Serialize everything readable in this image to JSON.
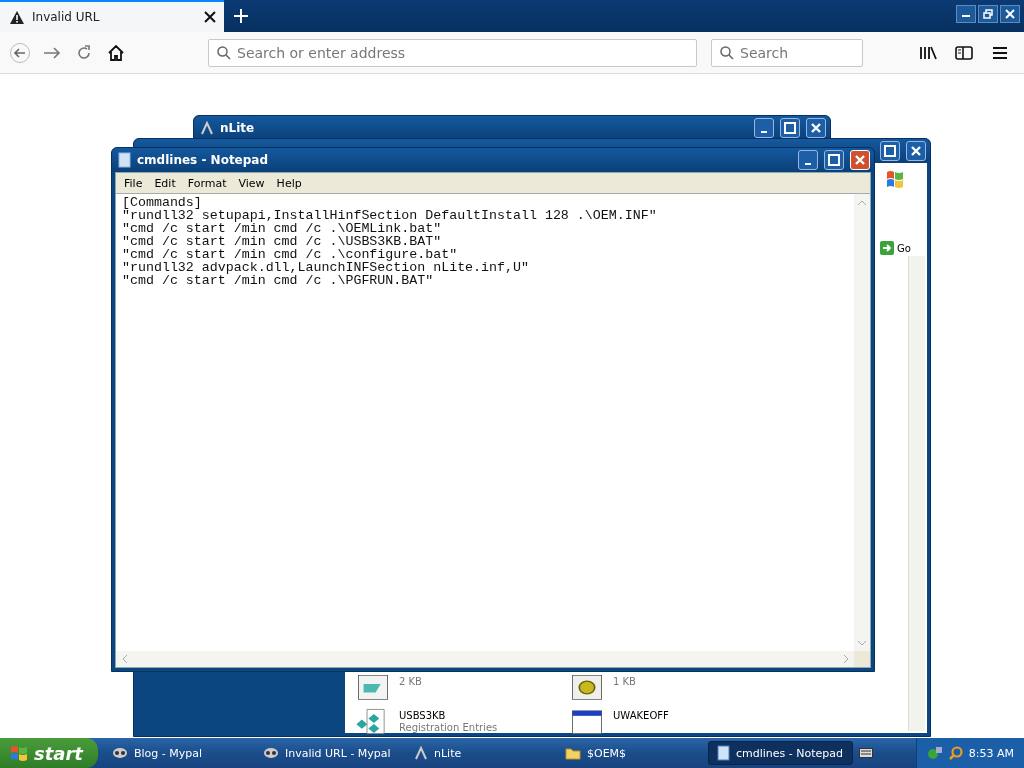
{
  "browser": {
    "tab": {
      "title": "Invalid URL"
    },
    "address_bar": {
      "placeholder": "Search or enter address"
    },
    "search_bar": {
      "placeholder": "Search"
    }
  },
  "nlite_window": {
    "title": "nLite"
  },
  "explorer_window": {
    "go_button": "Go",
    "files": [
      {
        "details": [
          "2 KB"
        ],
        "kind": "script"
      },
      {
        "details": [
          "1 KB"
        ],
        "kind": "batch"
      },
      {
        "name": "USBS3KB",
        "details": [
          "Registration Entries"
        ],
        "kind": "registry"
      },
      {
        "name": "UWAKEOFF",
        "kind": "program"
      }
    ]
  },
  "notepad": {
    "title": "cmdlines - Notepad",
    "menu": [
      "File",
      "Edit",
      "Format",
      "View",
      "Help"
    ],
    "lines": [
      "[Commands]",
      "\"rundll32 setupapi,InstallHinfSection DefaultInstall 128 .\\OEM.INF\"",
      "\"cmd /c start /min cmd /c .\\OEMLink.bat\"",
      "\"cmd /c start /min cmd /c .\\USBS3KB.BAT\"",
      "\"cmd /c start /min cmd /c .\\configure.bat\"",
      "\"rundll32 advpack.dll,LaunchINFSection nLite.inf,U\"",
      "\"cmd /c start /min cmd /c .\\PGFRUN.BAT\""
    ]
  },
  "taskbar": {
    "start": "start",
    "tasks": [
      {
        "label": "Blog - Mypal",
        "kind": "browser",
        "selected": false
      },
      {
        "label": "Invalid URL - Mypal",
        "kind": "browser",
        "selected": false
      },
      {
        "label": "nLite",
        "kind": "nlite",
        "selected": false
      },
      {
        "label": "$OEM$",
        "kind": "folder",
        "selected": false
      },
      {
        "label": "cmdlines - Notepad",
        "kind": "notepad",
        "selected": true
      }
    ],
    "clock": "8:53 AM"
  }
}
